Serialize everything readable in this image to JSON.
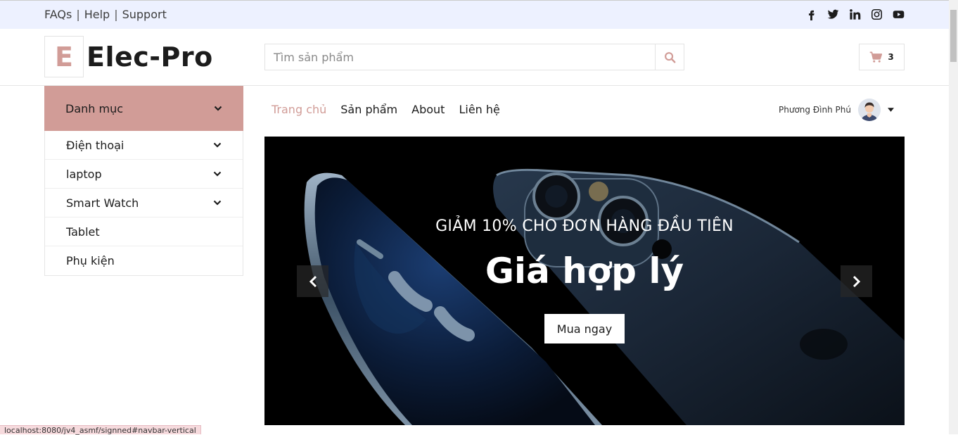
{
  "topbar": {
    "links": [
      "FAQs",
      "Help",
      "Support"
    ],
    "separator": "|",
    "social_icons": [
      "facebook-icon",
      "twitter-icon",
      "linkedin-icon",
      "instagram-icon",
      "youtube-icon"
    ]
  },
  "header": {
    "logo_letter": "E",
    "logo_text": "Elec-Pro",
    "search_placeholder": "Tìm sản phẩm",
    "search_icon": "search-icon",
    "cart_icon": "shopping-cart-icon",
    "cart_count": "3"
  },
  "sidebar": {
    "title": "Danh mục",
    "items": [
      {
        "label": "Điện thoại",
        "has_children": true
      },
      {
        "label": "laptop",
        "has_children": true
      },
      {
        "label": "Smart Watch",
        "has_children": true
      },
      {
        "label": "Tablet",
        "has_children": false
      },
      {
        "label": "Phụ kiện",
        "has_children": false
      }
    ]
  },
  "nav": {
    "items": [
      {
        "label": "Trang chủ",
        "active": true
      },
      {
        "label": "Sản phẩm",
        "active": false
      },
      {
        "label": "About",
        "active": false
      },
      {
        "label": "Liên hệ",
        "active": false
      }
    ],
    "user_name": "Phương Đình Phú"
  },
  "hero": {
    "subtitle": "GIẢM 10% CHO ĐƠN HÀNG ĐẦU TIÊN",
    "title": "Giá hợp lý",
    "button_label": "Mua ngay"
  },
  "status_url": "localhost:8080/jv4_asmf/signned#navbar-vertical",
  "colors": {
    "accent": "#d19c97",
    "topbar_bg": "#edf1ff"
  }
}
